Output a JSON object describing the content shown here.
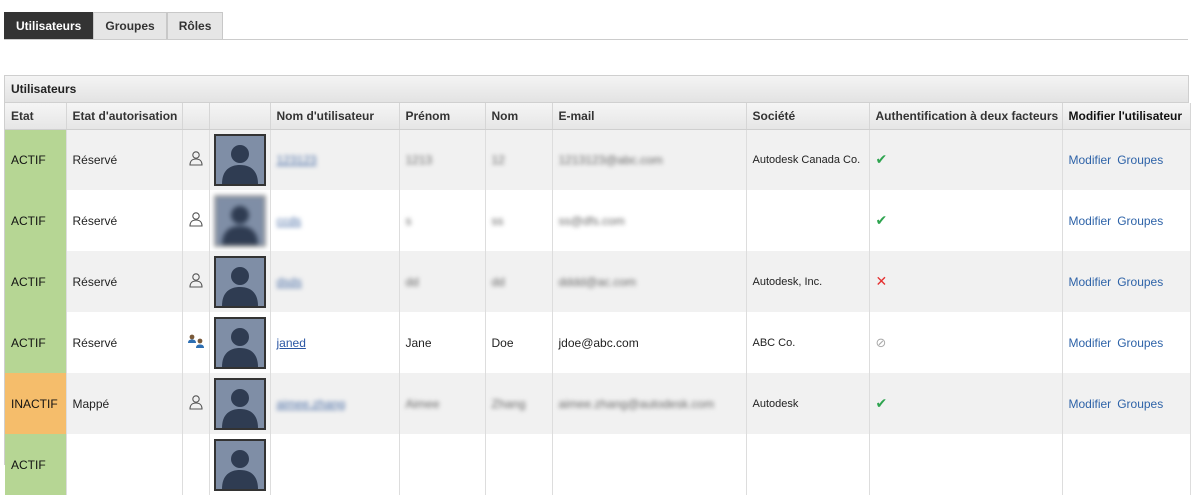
{
  "tabs": [
    {
      "label": "Utilisateurs",
      "active": true
    },
    {
      "label": "Groupes",
      "active": false
    },
    {
      "label": "Rôles",
      "active": false
    }
  ],
  "panel": {
    "title": "Utilisateurs"
  },
  "columns": {
    "etat": "Etat",
    "auth_state": "Etat d'autorisation",
    "username": "Nom d'utilisateur",
    "first_name": "Prénom",
    "last_name": "Nom",
    "email": "E-mail",
    "company": "Société",
    "two_factor": "Authentification à deux facteurs",
    "edit": "Modifier l'utilisateur"
  },
  "actions": {
    "modify": "Modifier",
    "groups": "Groupes"
  },
  "rows": [
    {
      "state": "ACTIF",
      "auth": "Réservé",
      "username": "123123",
      "first": "1213",
      "last": "12",
      "email": "1213123@abc.com",
      "company": "Autodesk Canada Co.",
      "twofa": "✔"
    },
    {
      "state": "ACTIF",
      "auth": "Réservé",
      "username": "ccds",
      "first": "s",
      "last": "ss",
      "email": "ss@dfs.com",
      "company": "",
      "twofa": "✔"
    },
    {
      "state": "ACTIF",
      "auth": "Réservé",
      "username": "dsds",
      "first": "dd",
      "last": "dd",
      "email": "dddd@ac.com",
      "company": "Autodesk, Inc.",
      "twofa": "✕"
    },
    {
      "state": "ACTIF",
      "auth": "Réservé",
      "username": "janed",
      "first": "Jane",
      "last": "Doe",
      "email": "jdoe@abc.com",
      "company": "ABC Co.",
      "twofa": "⊘"
    },
    {
      "state": "INACTIF",
      "auth": "Mappé",
      "username": "aimee.zhang",
      "first": "Aimee",
      "last": "Zhang",
      "email": "aimee.zhang@autodesk.com",
      "company": "Autodesk",
      "twofa": "✔"
    },
    {
      "state": "ACTIF",
      "auth": "",
      "username": "",
      "first": "",
      "last": "",
      "email": "",
      "company": "",
      "twofa": ""
    }
  ],
  "colors": {
    "active": "#b6d694",
    "inactive": "#f5bd6b",
    "check": "#2ea44f",
    "cross": "#e53030",
    "link": "#2e63a8"
  }
}
